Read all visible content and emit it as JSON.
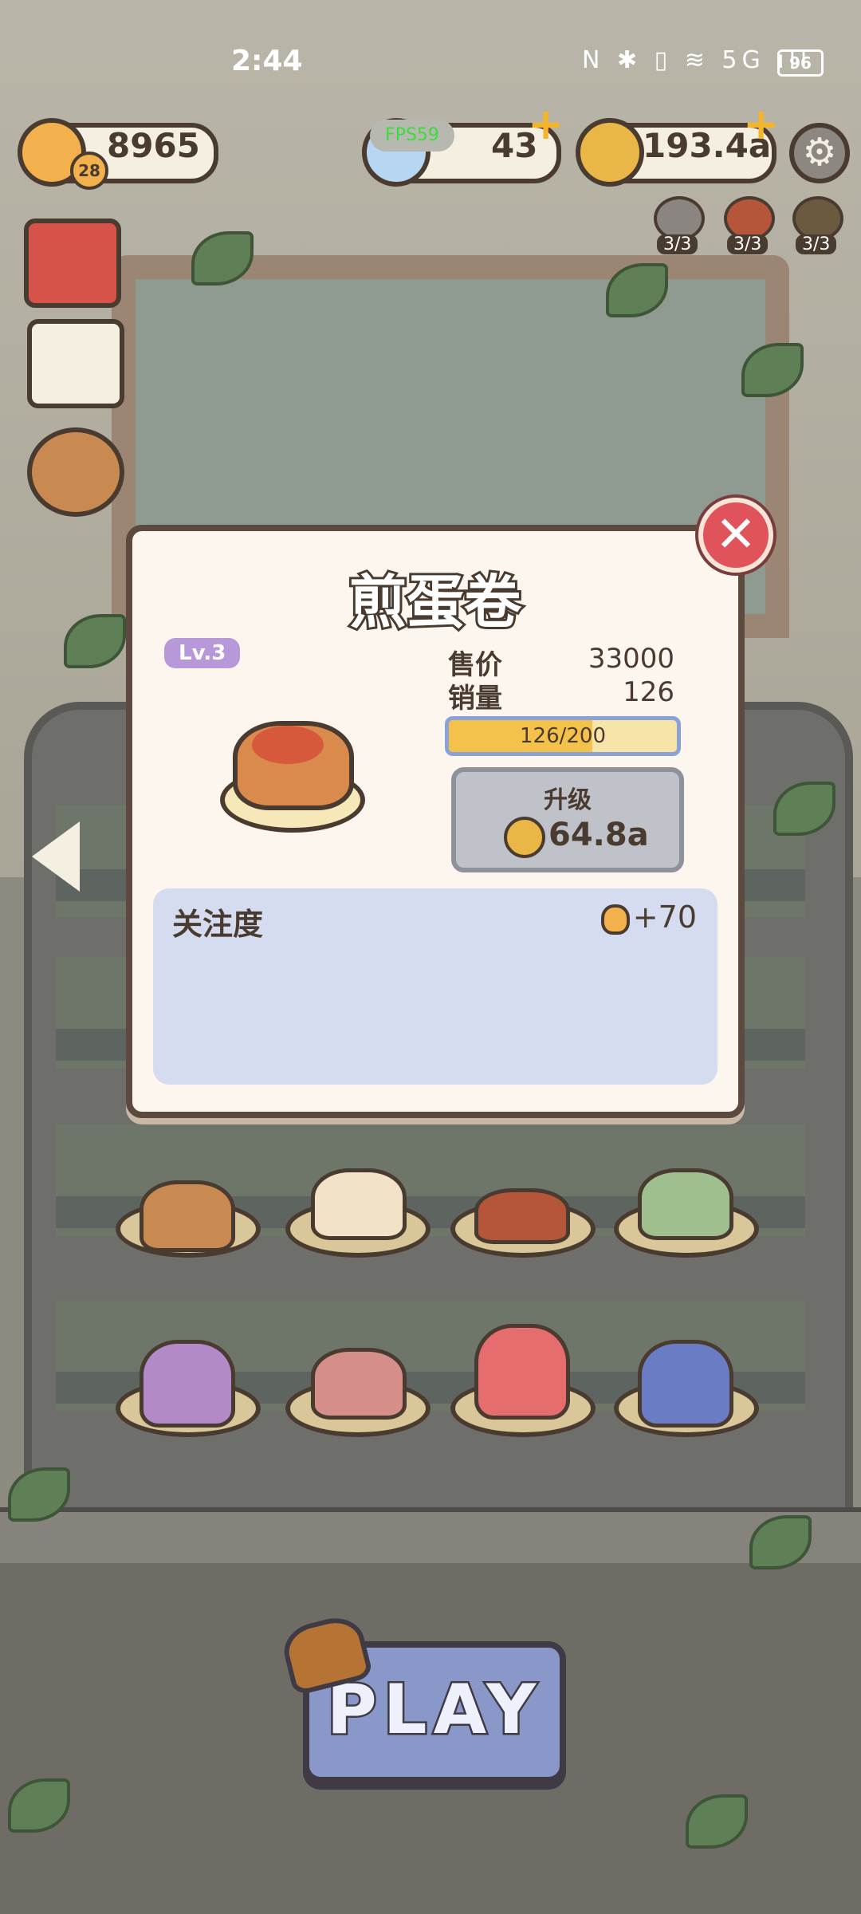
{
  "status_bar": {
    "time": "2:44",
    "icons": "N ✱ ▯ ≋ 5G ıll",
    "battery": "96"
  },
  "resources": {
    "fist_count": "8965",
    "fist_level": "28",
    "fps_label": "FPS59",
    "gems": "43",
    "coins": "193.4a"
  },
  "boosters": [
    {
      "count": "3/3"
    },
    {
      "count": "3/3"
    },
    {
      "count": "3/3"
    }
  ],
  "modal": {
    "title": "煎蛋卷",
    "level": "Lv.3",
    "price_label": "售价",
    "price_value": "33000",
    "sales_label": "销量",
    "sales_value": "126",
    "progress_text": "126/200",
    "progress_fraction": 0.63,
    "upgrade_label": "升级",
    "upgrade_cost": "64.8a",
    "attention_label": "关注度",
    "attention_value": "+70"
  },
  "play_label": "PLAY",
  "colors": {
    "modal_bg": "#fdf6ef",
    "close": "#e0535b",
    "level_badge": "#b798d8",
    "progress_fill": "#f4c24a",
    "play_button": "#8a97c9"
  }
}
